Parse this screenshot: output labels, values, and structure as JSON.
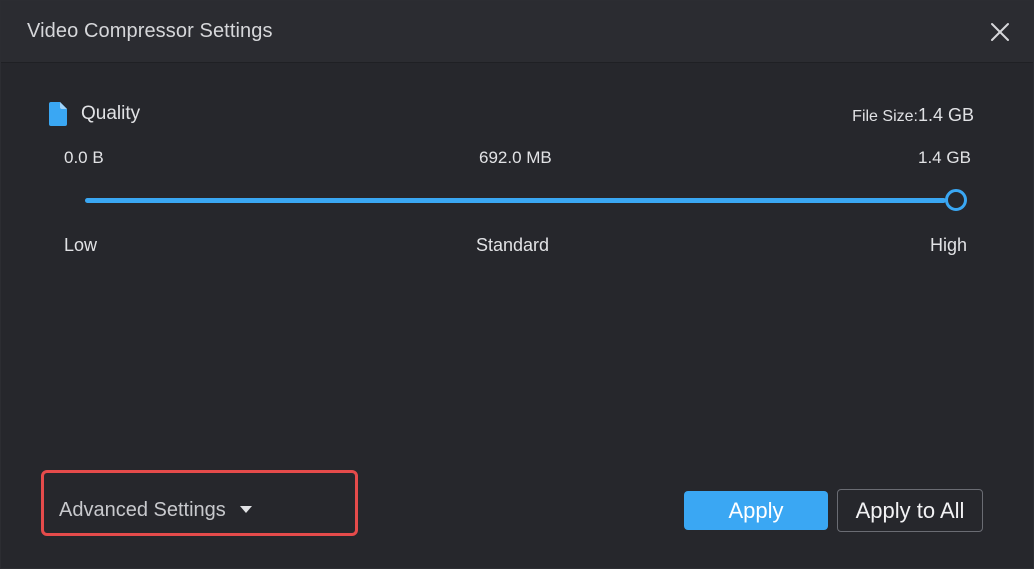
{
  "dialog": {
    "title": "Video Compressor Settings"
  },
  "quality": {
    "label": "Quality",
    "file_size_label": "File Size:",
    "file_size_value": "1.4 GB",
    "size_ticks": [
      "0.0 B",
      "692.0 MB",
      "1.4 GB"
    ],
    "levels": [
      "Low",
      "Standard",
      "High"
    ],
    "slider_value": 1.0
  },
  "footer": {
    "advanced_label": "Advanced Settings",
    "apply_label": "Apply",
    "apply_all_label": "Apply to All"
  },
  "icons": {
    "close": "close-icon",
    "quality": "document-icon",
    "advanced_caret": "caret-down-icon"
  },
  "colors": {
    "accent": "#3aa7f3",
    "highlight_border": "#e54b4b",
    "background": "#26272c"
  }
}
